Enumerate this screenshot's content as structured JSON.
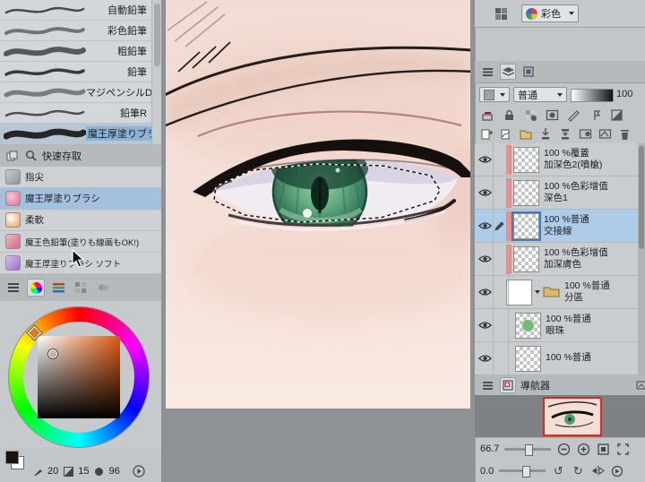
{
  "colors": {
    "selection_blue": "#aecbe8",
    "layer_tag_salmon": "#e28c8c",
    "canvas_skin": "#f4ded6",
    "iris_green": "#4f9a72",
    "navigator_frame_red": "#dd2a1e"
  },
  "brush_panel": {
    "brushes": [
      {
        "label": "自動鉛筆"
      },
      {
        "label": "彩色鉛筆"
      },
      {
        "label": "粗鉛筆"
      },
      {
        "label": "鉛筆"
      },
      {
        "label": "マジペンシルD"
      },
      {
        "label": "鉛筆R"
      },
      {
        "label": "魔王厚塗りブラシ"
      }
    ]
  },
  "quick_access": {
    "title": "快速存取",
    "items": [
      {
        "label": "指尖"
      },
      {
        "label": "魔王厚塗りブラシ"
      },
      {
        "label": "柔軟"
      },
      {
        "label": "魔王色鉛筆(塗りも線画もOK!)"
      },
      {
        "label": "魔王厚塗りブラシ ソフト"
      }
    ]
  },
  "color_panel": {
    "stat_pen": "20",
    "stat_density": "15",
    "stat_size": "96"
  },
  "top_toolbar": {
    "color_mode": "彩色"
  },
  "layer_panel": {
    "blend_mode": "普通",
    "opacity": "100",
    "rows": [
      {
        "info": "100 %覆蓋",
        "name": "加深色2(噴槍)"
      },
      {
        "info": "100 %色彩增值",
        "name": "深色1"
      },
      {
        "info": "100 %普通",
        "name": "交接線"
      },
      {
        "info": "100 %色彩增值",
        "name": "加深膚色"
      },
      {
        "info": "100 %普通",
        "name": "分區"
      },
      {
        "info": "100 %普通",
        "name": "眼珠"
      },
      {
        "info": "100 %普通",
        "name": ""
      }
    ]
  },
  "navigator": {
    "title": "導航器",
    "zoom": "66.7",
    "rotation": "0.0"
  }
}
